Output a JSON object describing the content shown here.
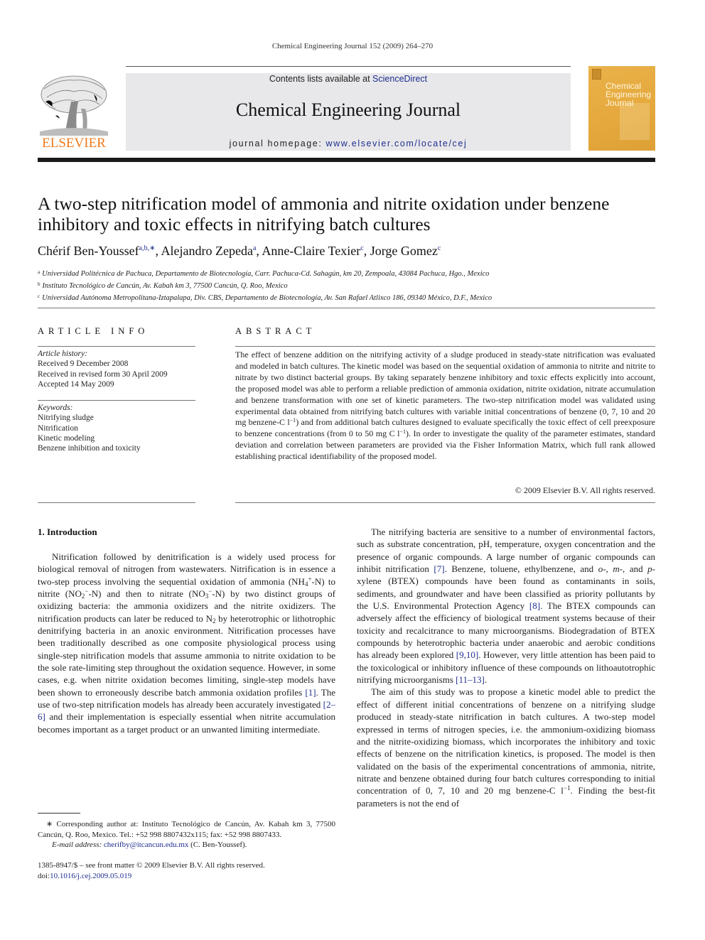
{
  "running_head": "Chemical Engineering Journal 152 (2009) 264–270",
  "header": {
    "publisher_logo_text": "ELSEVIER",
    "contents_prefix": "Contents lists available at ",
    "contents_link": "ScienceDirect",
    "journal_title": "Chemical Engineering Journal",
    "homepage_prefix": "journal homepage: ",
    "homepage_link": "www.elsevier.com/locate/cej",
    "cover_title_lines": [
      "Chemical",
      "Engineering",
      "Journal"
    ]
  },
  "colors": {
    "link": "#1f2e8f",
    "elsevier_orange": "#f07a1c",
    "banner_gray": "#e8e8ea",
    "cover_gold": "#e5a93d"
  },
  "article": {
    "title": "A two-step nitrification model of ammonia and nitrite oxidation under benzene inhibitory and toxic effects in nitrifying batch cultures",
    "authors": [
      {
        "name": "Chérif Ben-Youssef",
        "sup": "a,b,∗",
        "sep": ", "
      },
      {
        "name": "Alejandro Zepeda",
        "sup": "a",
        "sep": ", "
      },
      {
        "name": "Anne-Claire Texier",
        "sup": "c",
        "sep": ", "
      },
      {
        "name": "Jorge Gomez",
        "sup": "c",
        "sep": ""
      }
    ],
    "affiliations": [
      {
        "mark": "a",
        "text": "Universidad Politécnica de Pachuca, Departamento de Biotecnología, Carr. Pachuca-Cd. Sahagún, km 20, Zempoala, 43084 Pachuca, Hgo., Mexico"
      },
      {
        "mark": "b",
        "text": "Instituto Tecnológico de Cancún, Av. Kabah km 3, 77500 Cancún, Q. Roo, Mexico"
      },
      {
        "mark": "c",
        "text": "Universidad Autónoma Metropolitana-Iztapalapa, Div. CBS, Departamento de Biotecnología, Av. San Rafael Atlixco 186, 09340 México, D.F., Mexico"
      }
    ]
  },
  "article_info": {
    "heading": "ARTICLE INFO",
    "history_label": "Article history:",
    "history": [
      "Received 9 December 2008",
      "Received in revised form 30 April 2009",
      "Accepted 14 May 2009"
    ],
    "keywords_label": "Keywords:",
    "keywords": [
      "Nitrifying sludge",
      "Nitrification",
      "Kinetic modeling",
      "Benzene inhibition and toxicity"
    ]
  },
  "abstract": {
    "heading": "ABSTRACT",
    "part1": "The effect of benzene addition on the nitrifying activity of a sludge produced in steady-state nitrification was evaluated and modeled in batch cultures. The kinetic model was based on the sequential oxidation of ammonia to nitrite and nitrite to nitrate by two distinct bacterial groups. By taking separately benzene inhibitory and toxic effects explicitly into account, the proposed model was able to perform a reliable prediction of ammonia oxidation, nitrite oxidation, nitrate accumulation and benzene transformation with one set of kinetic parameters. The two-step nitrification model was validated using experimental data obtained from nitrifying batch cultures with variable initial concentrations of benzene (0, 7, 10 and 20 mg benzene-C l",
    "sup1": "−1",
    "part2": ") and from additional batch cultures designed to evaluate specifically the toxic effect of cell preexposure to benzene concentrations (from 0 to 50 mg C l",
    "sup2": "−1",
    "part3": "). In order to investigate the quality of the parameter estimates, standard deviation and correlation between parameters are provided via the Fisher Information Matrix, which full rank allowed establishing practical identifiability of the proposed model.",
    "copyright": "© 2009 Elsevier B.V. All rights reserved."
  },
  "introduction": {
    "heading": "1.  Introduction",
    "left_p1": {
      "t1": "Nitrification followed by denitrification is a widely used process for biological removal of nitrogen from wastewaters. Nitrification is in essence a two-step process involving the sequential oxidation of ammonia (NH",
      "nh_sub": "4",
      "nh_sup": "+",
      "t2": "-N) to nitrite (NO",
      "no2_sub": "2",
      "no2_sup": "−",
      "t3": "-N) and then to nitrate (NO",
      "no3_sub": "3",
      "no3_sup": "−",
      "t4": "-N) by two distinct groups of oxidizing bacteria: the ammonia oxidizers and the nitrite oxidizers. The nitrification products can later be reduced to N",
      "n2_sub": "2",
      "t5": " by heterotrophic or lithotrophic denitrifying bacteria in an anoxic environment. Nitrification processes have been traditionally described as one composite physiological process using single-step nitrification models that assume ammonia to nitrite oxidation to be the sole rate-limiting step throughout the oxidation sequence. However, in some cases, e.g. when nitrite oxidation becomes limiting, single-step models have been shown to erroneously describe batch ammonia oxidation profiles ",
      "ref1": "[1]",
      "t6": ". The use of two-step nitrification models has already been accurately investigated ",
      "ref2": "[2–6]",
      "t7": " and their implementation is especially essential when nitrite accumulation becomes important as a target product or an unwanted limiting intermediate."
    },
    "right_p1": {
      "t1": "The nitrifying bacteria are sensitive to a number of environmental factors, such as substrate concentration, pH, temperature, oxygen concentration and the presence of organic compounds. A large number of organic compounds can inhibit nitrification ",
      "ref7": "[7]",
      "t2": ". Benzene, toluene, ethylbenzene, and ",
      "o": "o",
      "t3": "-, ",
      "m": "m",
      "t4": "-, and ",
      "p": "p",
      "t5": "-xylene (BTEX) compounds have been found as contaminants in soils, sediments, and groundwater and have been classified as priority pollutants by the U.S. Environmental Protection Agency ",
      "ref8": "[8]",
      "t6": ". The BTEX compounds can adversely affect the efficiency of biological treatment systems because of their toxicity and recalcitrance to many microorganisms. Biodegradation of BTEX compounds by heterotrophic bacteria under anaerobic and aerobic conditions has already been explored ",
      "ref9": "[9,10]",
      "t7": ". However, very little attention has been paid to the toxicological or inhibitory influence of these compounds on lithoautotrophic nitrifying microorganisms ",
      "ref11": "[11–13]",
      "t8": "."
    },
    "right_p2": {
      "t1": "The aim of this study was to propose a kinetic model able to predict the effect of different initial concentrations of benzene on a nitrifying sludge produced in steady-state nitrification in batch cultures. A two-step model expressed in terms of nitrogen species, i.e. the ammonium-oxidizing biomass and the nitrite-oxidizing biomass, which incorporates the inhibitory and toxic effects of benzene on the nitrification kinetics, is proposed. The model is then validated on the basis of the experimental concentrations of ammonia, nitrite, nitrate and benzene obtained during four batch cultures corresponding to initial concentration of 0, 7, 10 and 20 mg benzene-C l",
      "sup": "−1",
      "t2": ". Finding the best-fit parameters is not the end of"
    }
  },
  "footnote": {
    "star": "∗",
    "text": "  Corresponding author at: Instituto Tecnológico de Cancún, Av. Kabah km 3, 77500 Cancún, Q. Roo, Mexico. Tel.: +52 998 8807432x115; fax: +52 998 8807433.",
    "email_label": "E-mail address: ",
    "email": "cherifby@itcancun.edu.mx",
    "email_suffix": " (C. Ben-Youssef)."
  },
  "front_matter": {
    "line1": "1385-8947/$ – see front matter © 2009 Elsevier B.V. All rights reserved.",
    "doi_label": "doi:",
    "doi": "10.1016/j.cej.2009.05.019"
  }
}
